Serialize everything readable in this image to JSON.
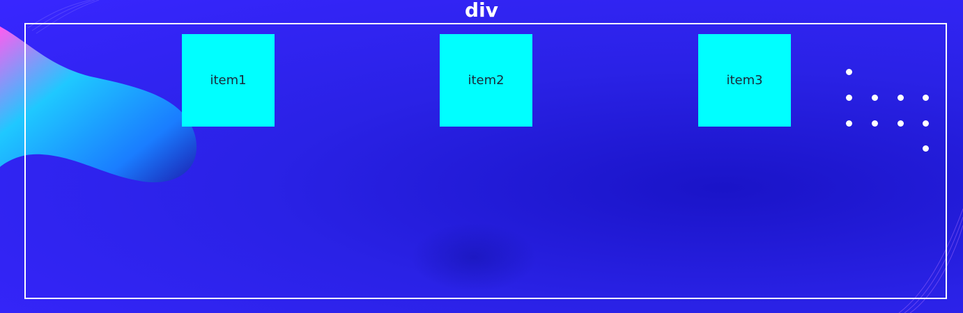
{
  "title": "div",
  "items": [
    {
      "label": "item1"
    },
    {
      "label": "item2"
    },
    {
      "label": "item3"
    }
  ],
  "colors": {
    "item_background": "#00ffff",
    "border": "#ffffff",
    "page_background": "#2a22e6"
  },
  "decorations": {
    "dot_pattern": "white-dots-icon"
  }
}
